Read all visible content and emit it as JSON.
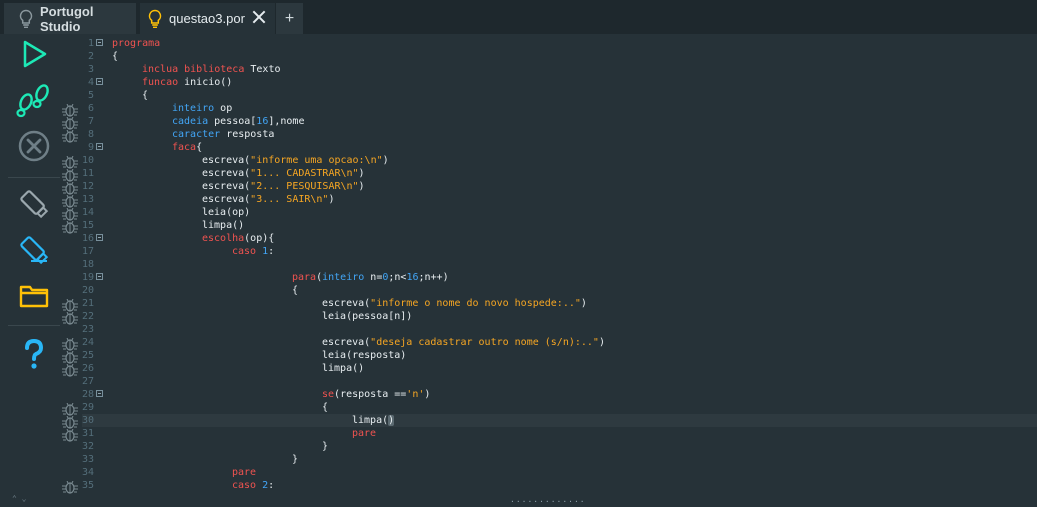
{
  "tabs": {
    "home_label": "Portugol Studio",
    "file_label": "questao3.por",
    "add_label": "+"
  },
  "toolbar": {
    "run": "play-icon",
    "debug": "step-footprints-icon",
    "stop": "stop-icon",
    "save": "save-usb-icon",
    "save_as": "save-as-usb-icon",
    "open": "folder-icon",
    "help": "help-icon",
    "accent": "#1de9b6",
    "help_color": "#29b6f6",
    "folder_color": "#ffc107"
  },
  "colors": {
    "keyword": "#ef5350",
    "type": "#42a5f5",
    "string": "#f6a623",
    "text": "#e8eef1",
    "background": "#263238"
  },
  "bottom": {
    "grip": "·············",
    "arrows": "⌃ ⌄"
  },
  "lines": [
    {
      "n": "1",
      "fold": true,
      "indent": 0,
      "toks": [
        [
          "kw",
          "programa"
        ]
      ]
    },
    {
      "n": "2",
      "fold": false,
      "indent": 0,
      "toks": [
        [
          "tx",
          "{"
        ]
      ]
    },
    {
      "n": "3",
      "fold": false,
      "indent": 1,
      "toks": [
        [
          "kw",
          "inclua biblioteca"
        ],
        [
          "tx",
          " Texto"
        ]
      ]
    },
    {
      "n": "4",
      "fold": true,
      "indent": 1,
      "toks": [
        [
          "kw",
          "funcao"
        ],
        [
          "tx",
          " inicio()"
        ]
      ]
    },
    {
      "n": "5",
      "fold": false,
      "indent": 1,
      "toks": [
        [
          "tx",
          "{"
        ]
      ]
    },
    {
      "n": "6",
      "fold": false,
      "indent": 2,
      "toks": [
        [
          "ty",
          "inteiro"
        ],
        [
          "tx",
          " op"
        ]
      ]
    },
    {
      "n": "7",
      "fold": false,
      "indent": 2,
      "toks": [
        [
          "ty",
          "cadeia"
        ],
        [
          "tx",
          " pessoa["
        ],
        [
          "nu",
          "16"
        ],
        [
          "tx",
          "],nome"
        ]
      ]
    },
    {
      "n": "8",
      "fold": false,
      "indent": 2,
      "toks": [
        [
          "ty",
          "caracter"
        ],
        [
          "tx",
          " resposta"
        ]
      ]
    },
    {
      "n": "9",
      "fold": true,
      "indent": 2,
      "toks": [
        [
          "kw",
          "faca"
        ],
        [
          "tx",
          "{"
        ]
      ]
    },
    {
      "n": "10",
      "fold": false,
      "indent": 3,
      "toks": [
        [
          "tx",
          "escreva("
        ],
        [
          "st",
          "\"informe uma opcao:\\n\""
        ],
        [
          "tx",
          ")"
        ]
      ]
    },
    {
      "n": "11",
      "fold": false,
      "indent": 3,
      "toks": [
        [
          "tx",
          "escreva("
        ],
        [
          "st",
          "\"1... CADASTRAR\\n\""
        ],
        [
          "tx",
          ")"
        ]
      ]
    },
    {
      "n": "12",
      "fold": false,
      "indent": 3,
      "toks": [
        [
          "tx",
          "escreva("
        ],
        [
          "st",
          "\"2... PESQUISAR\\n\""
        ],
        [
          "tx",
          ")"
        ]
      ]
    },
    {
      "n": "13",
      "fold": false,
      "indent": 3,
      "toks": [
        [
          "tx",
          "escreva("
        ],
        [
          "st",
          "\"3... SAIR\\n\""
        ],
        [
          "tx",
          ")"
        ]
      ]
    },
    {
      "n": "14",
      "fold": false,
      "indent": 3,
      "toks": [
        [
          "tx",
          "leia(op)"
        ]
      ]
    },
    {
      "n": "15",
      "fold": false,
      "indent": 3,
      "toks": [
        [
          "tx",
          "limpa()"
        ]
      ]
    },
    {
      "n": "16",
      "fold": true,
      "indent": 3,
      "toks": [
        [
          "kw",
          "escolha"
        ],
        [
          "tx",
          "(op){"
        ]
      ]
    },
    {
      "n": "17",
      "fold": false,
      "indent": 4,
      "toks": [
        [
          "kw",
          "caso"
        ],
        [
          "tx",
          " "
        ],
        [
          "nu",
          "1"
        ],
        [
          "tx",
          ":"
        ]
      ]
    },
    {
      "n": "18",
      "fold": false,
      "indent": 0,
      "toks": []
    },
    {
      "n": "19",
      "fold": true,
      "indent": 6,
      "toks": [
        [
          "kw",
          "para"
        ],
        [
          "tx",
          "("
        ],
        [
          "ty",
          "inteiro"
        ],
        [
          "tx",
          " n="
        ],
        [
          "nu",
          "0"
        ],
        [
          "tx",
          ";n<"
        ],
        [
          "nu",
          "16"
        ],
        [
          "tx",
          ";n++)"
        ]
      ]
    },
    {
      "n": "20",
      "fold": false,
      "indent": 6,
      "toks": [
        [
          "tx",
          "{"
        ]
      ]
    },
    {
      "n": "21",
      "fold": false,
      "indent": 7,
      "toks": [
        [
          "tx",
          "escreva("
        ],
        [
          "st",
          "\"informe o nome do novo hospede:..\""
        ],
        [
          "tx",
          ")"
        ]
      ]
    },
    {
      "n": "22",
      "fold": false,
      "indent": 7,
      "toks": [
        [
          "tx",
          "leia(pessoa[n])"
        ]
      ]
    },
    {
      "n": "23",
      "fold": false,
      "indent": 0,
      "toks": []
    },
    {
      "n": "24",
      "fold": false,
      "indent": 7,
      "toks": [
        [
          "tx",
          "escreva("
        ],
        [
          "st",
          "\"deseja cadastrar outro nome (s/n):..\""
        ],
        [
          "tx",
          ")"
        ]
      ]
    },
    {
      "n": "25",
      "fold": false,
      "indent": 7,
      "toks": [
        [
          "tx",
          "leia(resposta)"
        ]
      ]
    },
    {
      "n": "26",
      "fold": false,
      "indent": 7,
      "toks": [
        [
          "tx",
          "limpa()"
        ]
      ]
    },
    {
      "n": "27",
      "fold": false,
      "indent": 0,
      "toks": []
    },
    {
      "n": "28",
      "fold": true,
      "indent": 7,
      "toks": [
        [
          "kw",
          "se"
        ],
        [
          "tx",
          "(resposta =="
        ],
        [
          "st",
          "'n'"
        ],
        [
          "tx",
          ")"
        ]
      ]
    },
    {
      "n": "29",
      "fold": false,
      "indent": 7,
      "toks": [
        [
          "tx",
          "{"
        ]
      ]
    },
    {
      "n": "30",
      "fold": false,
      "indent": 8,
      "current": true,
      "toks": [
        [
          "tx",
          "limpa("
        ],
        [
          "caret",
          ")"
        ]
      ]
    },
    {
      "n": "31",
      "fold": false,
      "indent": 8,
      "toks": [
        [
          "kw",
          "pare"
        ]
      ]
    },
    {
      "n": "32",
      "fold": false,
      "indent": 7,
      "toks": [
        [
          "tx",
          "}"
        ]
      ]
    },
    {
      "n": "33",
      "fold": false,
      "indent": 6,
      "toks": [
        [
          "tx",
          "}"
        ]
      ]
    },
    {
      "n": "34",
      "fold": false,
      "indent": 4,
      "toks": [
        [
          "kw",
          "pare"
        ]
      ]
    },
    {
      "n": "35",
      "fold": false,
      "indent": 4,
      "toks": [
        [
          "kw",
          "caso"
        ],
        [
          "tx",
          " "
        ],
        [
          "nu",
          "2"
        ],
        [
          "tx",
          ":"
        ]
      ]
    }
  ]
}
